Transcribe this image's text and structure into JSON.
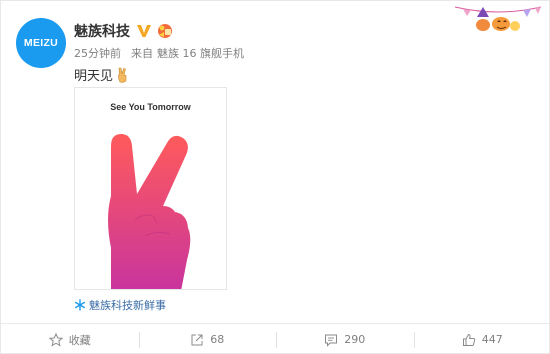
{
  "post": {
    "avatar_text": "MEIZU",
    "username": "魅族科技",
    "time": "25分钟前",
    "source_prefix": "来自",
    "source_device": "魅族 16 旗舰手机",
    "text": "明天见",
    "image_caption": "See You Tomorrow",
    "source_link": "魅族科技新鲜事"
  },
  "actions": {
    "favorite_label": "收藏",
    "repost_count": "68",
    "comment_count": "290",
    "like_count": "447"
  },
  "icons": {
    "verified": "verified-v-icon",
    "vip": "vip-badge-icon",
    "emoji": "peace-hand-emoji-icon",
    "source": "snowflake-icon",
    "decor": "halloween-decoration",
    "favorite": "star-icon",
    "repost": "share-arrow-icon",
    "comment": "comment-bubble-icon",
    "like": "thumbs-up-icon"
  },
  "colors": {
    "avatar_bg": "#1a9bf0",
    "link": "#3b6da7",
    "verified": "#f5a623",
    "hand_top": "#ff5b5b",
    "hand_bottom": "#c9349e"
  }
}
